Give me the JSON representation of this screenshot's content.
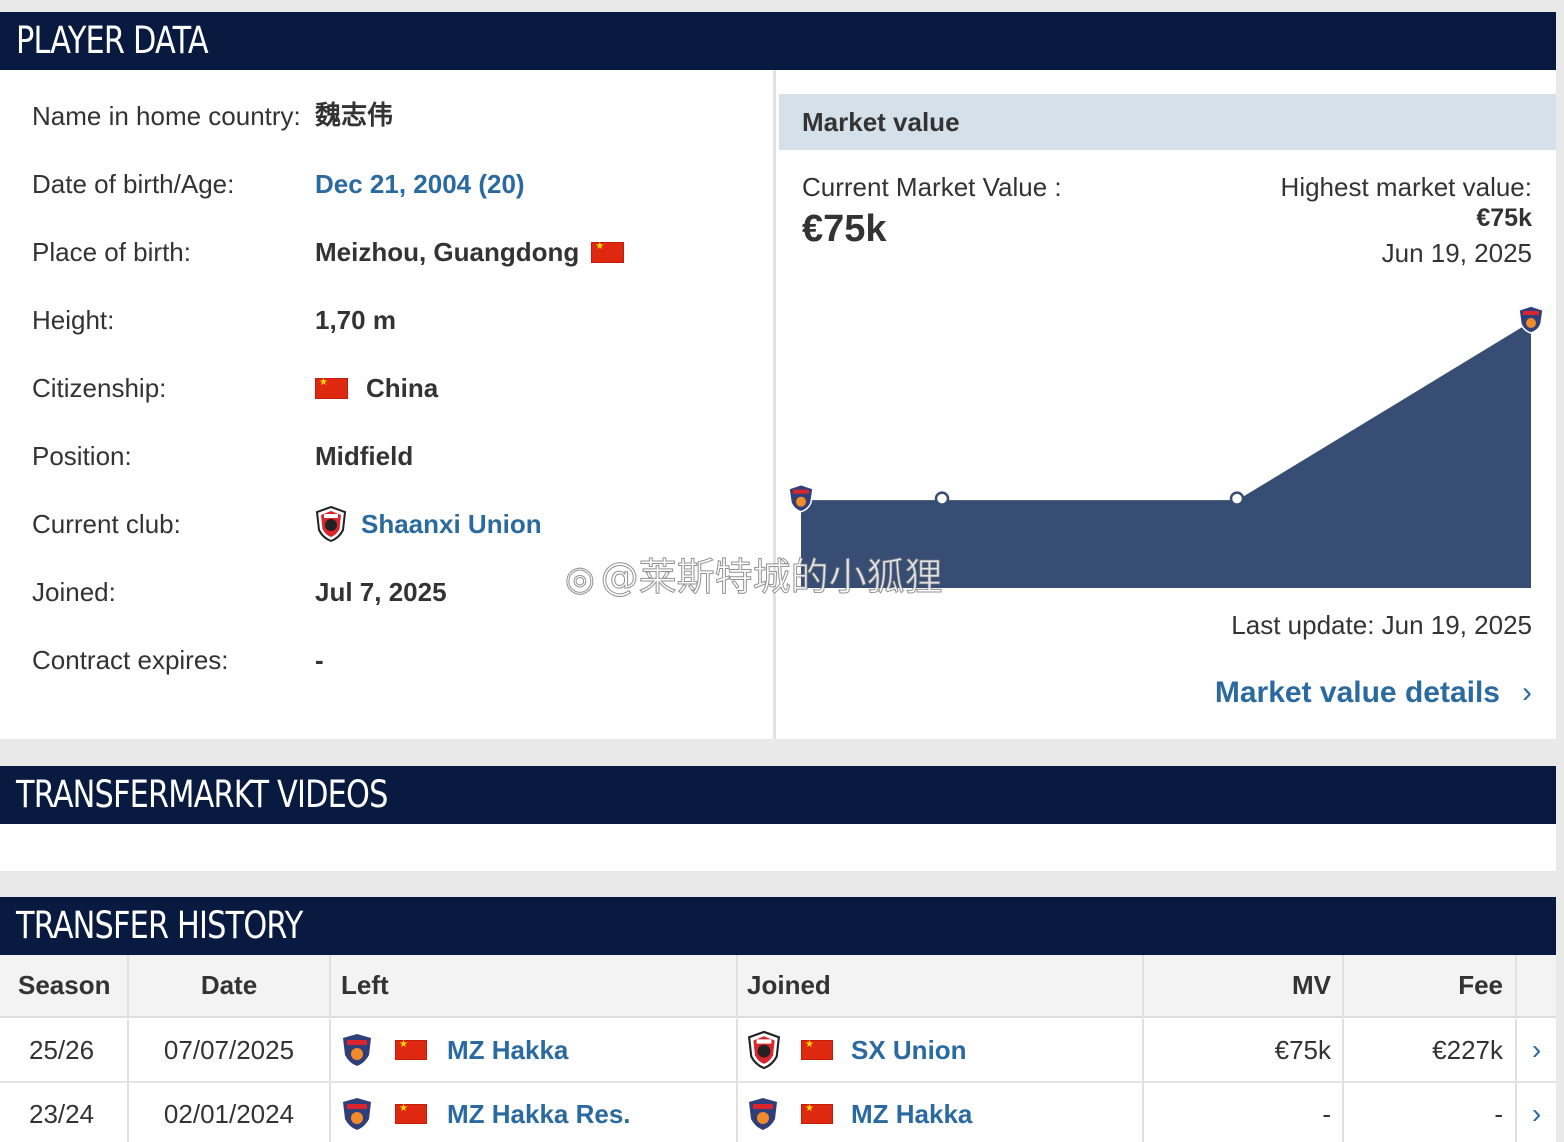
{
  "player_data": {
    "title": "PLAYER DATA",
    "rows": [
      {
        "label": "Name in home country:",
        "value": "魏志伟"
      },
      {
        "label": "Date of birth/Age:",
        "value": "Dec 21, 2004 (20)"
      },
      {
        "label": "Place of birth:",
        "value": "Meizhou, Guangdong"
      },
      {
        "label": "Height:",
        "value": "1,70 m"
      },
      {
        "label": "Citizenship:",
        "value": "China"
      },
      {
        "label": "Position:",
        "value": "Midfield"
      },
      {
        "label": "Current club:",
        "value": "Shaanxi Union"
      },
      {
        "label": "Joined:",
        "value": "Jul 7, 2025"
      },
      {
        "label": "Contract expires:",
        "value": "-"
      }
    ]
  },
  "market_value": {
    "header": "Market value",
    "current_label": "Current Market Value :",
    "current_value": "€75k",
    "highest_label": "Highest market value:",
    "highest_value": "€75k",
    "highest_date": "Jun 19, 2025",
    "last_update": "Last update: Jun 19, 2025",
    "details_link": "Market value details",
    "colors": {
      "fill": "#374d73",
      "line": "#ffffff"
    }
  },
  "chart_data": {
    "type": "area",
    "points": [
      {
        "label": "start",
        "value": 25
      },
      {
        "label": "p2",
        "value": 25
      },
      {
        "label": "p3",
        "value": 25
      },
      {
        "label": "Jun 19, 2025",
        "value": 75
      }
    ],
    "unit": "€k"
  },
  "videos": {
    "title": "TRANSFERMARKT VIDEOS"
  },
  "transfer_history": {
    "title": "TRANSFER HISTORY",
    "columns": [
      "Season",
      "Date",
      "Left",
      "Joined",
      "MV",
      "Fee"
    ],
    "rows": [
      {
        "season": "25/26",
        "date": "07/07/2025",
        "left": "MZ Hakka",
        "joined": "SX Union",
        "mv": "€75k",
        "fee": "€227k"
      },
      {
        "season": "23/24",
        "date": "02/01/2024",
        "left": "MZ Hakka Res.",
        "joined": "MZ Hakka",
        "mv": "-",
        "fee": "-"
      }
    ]
  },
  "watermark": "@莱斯特城的小狐狸"
}
